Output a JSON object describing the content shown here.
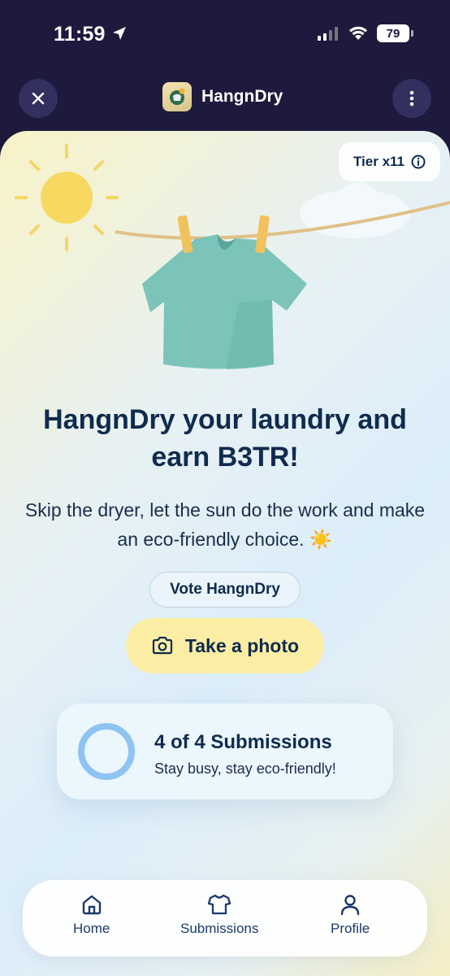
{
  "status": {
    "time": "11:59",
    "battery": "79"
  },
  "header": {
    "title": "HangnDry",
    "close_icon": "close-icon",
    "menu_icon": "more-vertical-icon"
  },
  "tier": {
    "label": "Tier x11",
    "icon": "info-icon"
  },
  "hero": {
    "headline": "HangnDry your laundry and earn B3TR!",
    "subtitle": "Skip the dryer, let the sun do the work and make an eco-friendly choice. ☀️"
  },
  "vote": {
    "label": "Vote HangnDry"
  },
  "photo_button": {
    "label": "Take a photo",
    "icon": "camera-icon"
  },
  "submissions": {
    "title": "4 of 4 Submissions",
    "subtitle": "Stay busy, stay eco-friendly!",
    "completed": 4,
    "total": 4
  },
  "nav": [
    {
      "label": "Home",
      "icon": "home-icon"
    },
    {
      "label": "Submissions",
      "icon": "shirt-icon"
    },
    {
      "label": "Profile",
      "icon": "user-icon"
    }
  ],
  "colors": {
    "header_bg": "#1d1a3d",
    "text_primary": "#0f2b4e",
    "accent_yellow": "#fbeea4",
    "ring_blue": "#8ec3f2"
  }
}
